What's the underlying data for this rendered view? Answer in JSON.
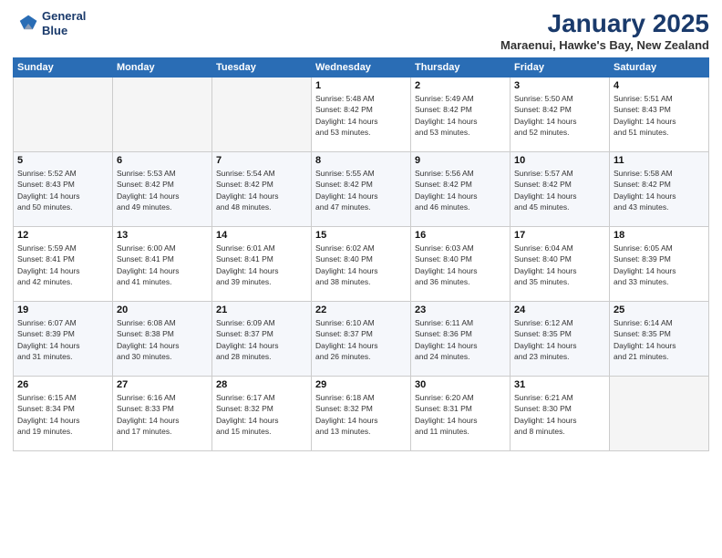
{
  "header": {
    "logo_line1": "General",
    "logo_line2": "Blue",
    "month": "January 2025",
    "location": "Maraenui, Hawke's Bay, New Zealand"
  },
  "weekdays": [
    "Sunday",
    "Monday",
    "Tuesday",
    "Wednesday",
    "Thursday",
    "Friday",
    "Saturday"
  ],
  "weeks": [
    [
      {
        "day": "",
        "info": ""
      },
      {
        "day": "",
        "info": ""
      },
      {
        "day": "",
        "info": ""
      },
      {
        "day": "1",
        "info": "Sunrise: 5:48 AM\nSunset: 8:42 PM\nDaylight: 14 hours\nand 53 minutes."
      },
      {
        "day": "2",
        "info": "Sunrise: 5:49 AM\nSunset: 8:42 PM\nDaylight: 14 hours\nand 53 minutes."
      },
      {
        "day": "3",
        "info": "Sunrise: 5:50 AM\nSunset: 8:42 PM\nDaylight: 14 hours\nand 52 minutes."
      },
      {
        "day": "4",
        "info": "Sunrise: 5:51 AM\nSunset: 8:43 PM\nDaylight: 14 hours\nand 51 minutes."
      }
    ],
    [
      {
        "day": "5",
        "info": "Sunrise: 5:52 AM\nSunset: 8:43 PM\nDaylight: 14 hours\nand 50 minutes."
      },
      {
        "day": "6",
        "info": "Sunrise: 5:53 AM\nSunset: 8:42 PM\nDaylight: 14 hours\nand 49 minutes."
      },
      {
        "day": "7",
        "info": "Sunrise: 5:54 AM\nSunset: 8:42 PM\nDaylight: 14 hours\nand 48 minutes."
      },
      {
        "day": "8",
        "info": "Sunrise: 5:55 AM\nSunset: 8:42 PM\nDaylight: 14 hours\nand 47 minutes."
      },
      {
        "day": "9",
        "info": "Sunrise: 5:56 AM\nSunset: 8:42 PM\nDaylight: 14 hours\nand 46 minutes."
      },
      {
        "day": "10",
        "info": "Sunrise: 5:57 AM\nSunset: 8:42 PM\nDaylight: 14 hours\nand 45 minutes."
      },
      {
        "day": "11",
        "info": "Sunrise: 5:58 AM\nSunset: 8:42 PM\nDaylight: 14 hours\nand 43 minutes."
      }
    ],
    [
      {
        "day": "12",
        "info": "Sunrise: 5:59 AM\nSunset: 8:41 PM\nDaylight: 14 hours\nand 42 minutes."
      },
      {
        "day": "13",
        "info": "Sunrise: 6:00 AM\nSunset: 8:41 PM\nDaylight: 14 hours\nand 41 minutes."
      },
      {
        "day": "14",
        "info": "Sunrise: 6:01 AM\nSunset: 8:41 PM\nDaylight: 14 hours\nand 39 minutes."
      },
      {
        "day": "15",
        "info": "Sunrise: 6:02 AM\nSunset: 8:40 PM\nDaylight: 14 hours\nand 38 minutes."
      },
      {
        "day": "16",
        "info": "Sunrise: 6:03 AM\nSunset: 8:40 PM\nDaylight: 14 hours\nand 36 minutes."
      },
      {
        "day": "17",
        "info": "Sunrise: 6:04 AM\nSunset: 8:40 PM\nDaylight: 14 hours\nand 35 minutes."
      },
      {
        "day": "18",
        "info": "Sunrise: 6:05 AM\nSunset: 8:39 PM\nDaylight: 14 hours\nand 33 minutes."
      }
    ],
    [
      {
        "day": "19",
        "info": "Sunrise: 6:07 AM\nSunset: 8:39 PM\nDaylight: 14 hours\nand 31 minutes."
      },
      {
        "day": "20",
        "info": "Sunrise: 6:08 AM\nSunset: 8:38 PM\nDaylight: 14 hours\nand 30 minutes."
      },
      {
        "day": "21",
        "info": "Sunrise: 6:09 AM\nSunset: 8:37 PM\nDaylight: 14 hours\nand 28 minutes."
      },
      {
        "day": "22",
        "info": "Sunrise: 6:10 AM\nSunset: 8:37 PM\nDaylight: 14 hours\nand 26 minutes."
      },
      {
        "day": "23",
        "info": "Sunrise: 6:11 AM\nSunset: 8:36 PM\nDaylight: 14 hours\nand 24 minutes."
      },
      {
        "day": "24",
        "info": "Sunrise: 6:12 AM\nSunset: 8:35 PM\nDaylight: 14 hours\nand 23 minutes."
      },
      {
        "day": "25",
        "info": "Sunrise: 6:14 AM\nSunset: 8:35 PM\nDaylight: 14 hours\nand 21 minutes."
      }
    ],
    [
      {
        "day": "26",
        "info": "Sunrise: 6:15 AM\nSunset: 8:34 PM\nDaylight: 14 hours\nand 19 minutes."
      },
      {
        "day": "27",
        "info": "Sunrise: 6:16 AM\nSunset: 8:33 PM\nDaylight: 14 hours\nand 17 minutes."
      },
      {
        "day": "28",
        "info": "Sunrise: 6:17 AM\nSunset: 8:32 PM\nDaylight: 14 hours\nand 15 minutes."
      },
      {
        "day": "29",
        "info": "Sunrise: 6:18 AM\nSunset: 8:32 PM\nDaylight: 14 hours\nand 13 minutes."
      },
      {
        "day": "30",
        "info": "Sunrise: 6:20 AM\nSunset: 8:31 PM\nDaylight: 14 hours\nand 11 minutes."
      },
      {
        "day": "31",
        "info": "Sunrise: 6:21 AM\nSunset: 8:30 PM\nDaylight: 14 hours\nand 8 minutes."
      },
      {
        "day": "",
        "info": ""
      }
    ]
  ]
}
